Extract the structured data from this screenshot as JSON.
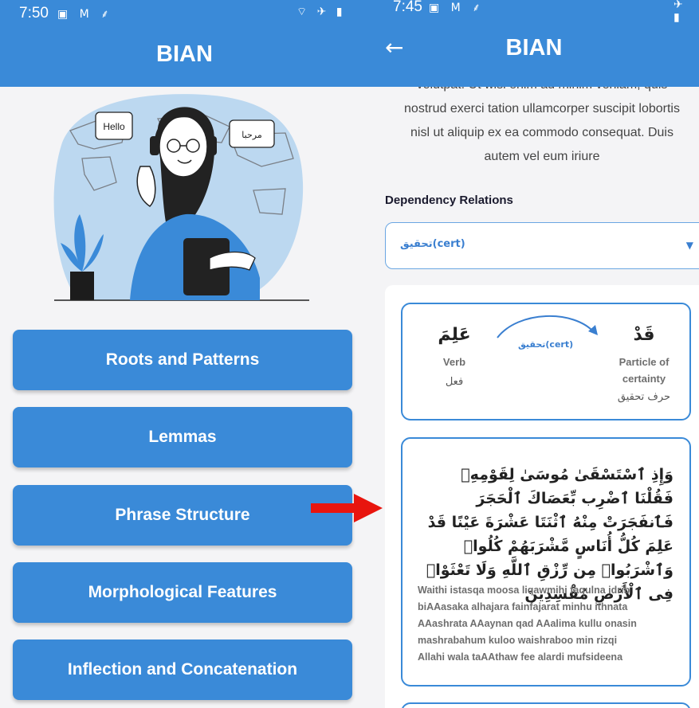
{
  "left_screen": {
    "status_time": "7:50",
    "status_icons": "▣ M ⸙",
    "status_right": "⌔ ✈ ▮",
    "app_title": "BIAN",
    "illustration": {
      "bubble_left": "Hello",
      "bubble_right": "مرحبا"
    },
    "menu": [
      {
        "label": "Roots and Patterns"
      },
      {
        "label": "Lemmas"
      },
      {
        "label": "Phrase Structure"
      },
      {
        "label": "Morphological Features"
      },
      {
        "label": "Inflection and Concatenation"
      }
    ]
  },
  "right_screen": {
    "status_time": "7:45",
    "status_icons": "▣ M ⸙",
    "status_right": "✈ ▮",
    "app_title": "BIAN",
    "lorem_lines": [
      "volutpat. Ut wisi enim ad minim veniam, quis",
      "nostrud exerci tation ullamcorper suscipit lobortis",
      "nisl ut aliquip ex ea commodo consequat. Duis",
      "autem vel eum iriure"
    ],
    "dependency_label": "Dependency Relations",
    "dropdown_value": "تحقيق(cert)",
    "relation": {
      "arrow_label": "تحقيق(cert)",
      "left_word": "عَلِمَ",
      "left_pos_en": "Verb",
      "left_pos_ar": "فعل",
      "right_word": "قَدْ",
      "right_pos_en_1": "Particle of",
      "right_pos_en_2": "certainty",
      "right_pos_ar": "حرف تحقيق"
    },
    "verse_arabic": "وَإِذِ ٱسْتَسْقَىٰ مُوسَىٰ لِقَوْمِهِۦ فَقُلْنَا ٱضْرِب بِّعَصَاكَ ٱلْحَجَرَ فَٱنفَجَرَتْ مِنْهُ ٱثْنَتَا عَشْرَةَ عَيْنًا قَدْ عَلِمَ كُلُّ أُنَاسٍ مَّشْرَبَهُمْ كُلُوا۟ وَٱشْرَبُوا۟ مِن رِّزْقِ ٱللَّهِ وَلَا تَعْثَوْا۟ فِى ٱلْأَرْضِ مُفْسِدِينَ",
    "verse_translit_lines": [
      "Waithi istasqa moosa liqawmihi faqulna idrib",
      "biAAasaka alhajara fainfajarat minhu ithnata",
      "AAashrata AAaynan qad AAalima kullu onasin",
      "mashrabahum kuloo waishraboo min rizqi",
      "Allahi wala taAAthaw fee alardi mufsideena"
    ]
  },
  "colors": {
    "primary": "#3a8ad8",
    "annotation_arrow": "#e8150e"
  }
}
